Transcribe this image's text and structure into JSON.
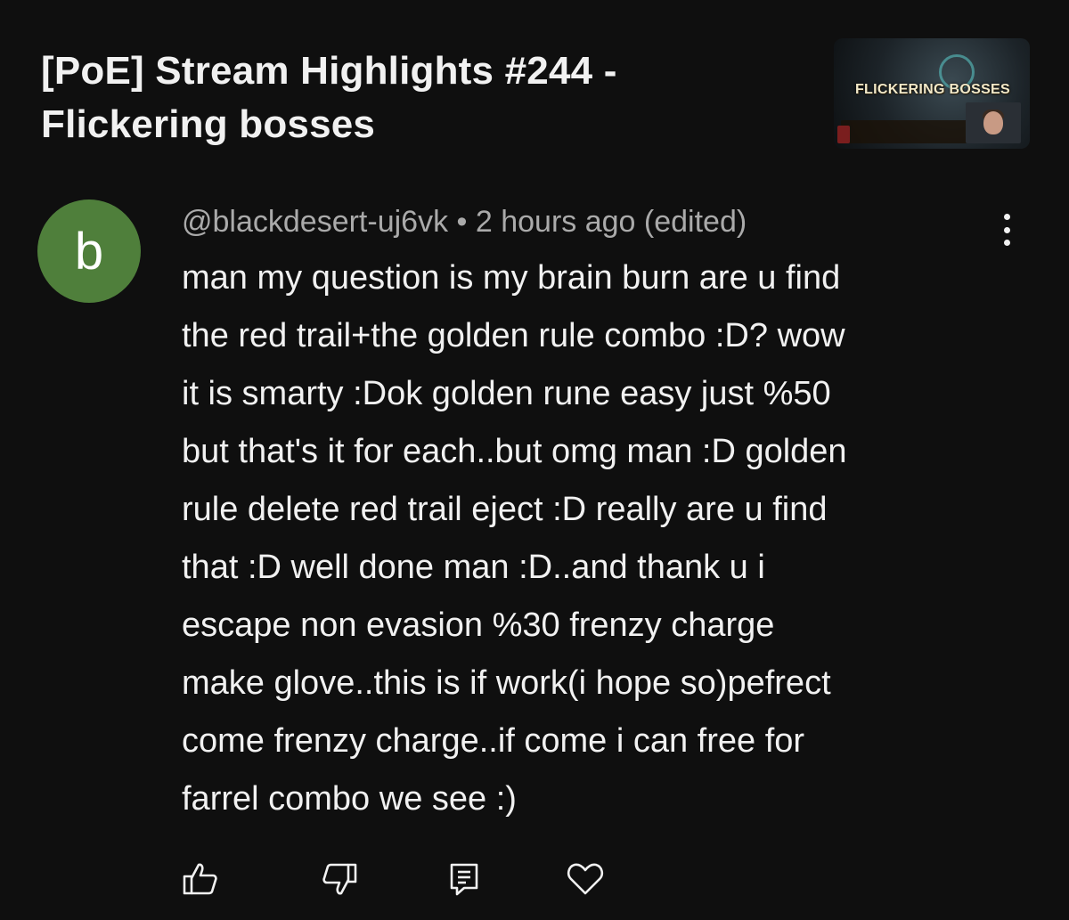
{
  "video": {
    "title": "[PoE] Stream Highlights #244 -\nFlickering bosses",
    "thumbnail_text": "FLICKERING BOSSES"
  },
  "comment": {
    "avatar_letter": "b",
    "avatar_color": "#4f7f3b",
    "author": "@blackdesert-uj6vk",
    "separator": " • ",
    "time": "2 hours ago (edited)",
    "body": "man my question is my brain burn are u find\nthe red trail+the golden rule combo :D? wow\nit is smarty :Dok golden rune easy just %50\nbut that's it for each..but omg man :D golden\nrule delete red trail eject :D really are u find\nthat :D well done man :D..and thank u i\nescape non evasion %30 frenzy charge\nmake glove..this is if work(i hope so)pefrect\ncome frenzy charge..if come i can free for\nfarrel combo we see :)"
  },
  "actions": {
    "like": "thumbs-up-icon",
    "dislike": "thumbs-down-icon",
    "reply": "reply-icon",
    "heart": "heart-icon",
    "more": "more-vert-icon"
  }
}
